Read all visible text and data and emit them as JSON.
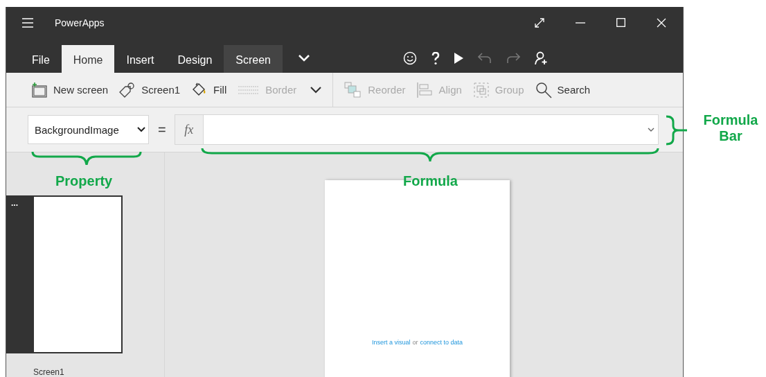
{
  "window": {
    "title": "PowerApps"
  },
  "tabs": [
    {
      "label": "File",
      "selected": false,
      "contextual": false
    },
    {
      "label": "Home",
      "selected": true,
      "contextual": false
    },
    {
      "label": "Insert",
      "selected": false,
      "contextual": false
    },
    {
      "label": "Design",
      "selected": false,
      "contextual": false
    },
    {
      "label": "Screen",
      "selected": false,
      "contextual": true
    }
  ],
  "app_actions": [
    {
      "kind": "smiley",
      "disabled": false
    },
    {
      "kind": "help",
      "disabled": false
    },
    {
      "kind": "play",
      "disabled": false
    },
    {
      "kind": "undo",
      "disabled": true
    },
    {
      "kind": "redo",
      "disabled": true
    },
    {
      "kind": "share",
      "disabled": false
    }
  ],
  "toolbar": {
    "left": [
      {
        "kind": "new-screen",
        "label": "New screen",
        "disabled": false
      },
      {
        "kind": "tag",
        "label": "Screen1",
        "disabled": false
      },
      {
        "kind": "fill",
        "label": "Fill",
        "disabled": false
      },
      {
        "kind": "border",
        "label": "Border",
        "disabled": true
      }
    ],
    "right": [
      {
        "kind": "reorder",
        "label": "Reorder",
        "disabled": true
      },
      {
        "kind": "align",
        "label": "Align",
        "disabled": true
      },
      {
        "kind": "group",
        "label": "Group",
        "disabled": true
      },
      {
        "kind": "search",
        "label": "Search",
        "disabled": false
      }
    ]
  },
  "formula_bar": {
    "property": "BackgroundImage",
    "equals": "=",
    "fx": "fx"
  },
  "screens": [
    {
      "label": "Screen1",
      "menu": "...",
      "selected": true
    }
  ],
  "canvas": {
    "parts": [
      {
        "kind": "link",
        "text": "Insert a visual"
      },
      {
        "kind": "text",
        "text": "or"
      },
      {
        "kind": "link",
        "text": "connect to data"
      }
    ]
  },
  "annotations": {
    "property": "Property",
    "formula": "Formula",
    "formula_bar": "Formula Bar"
  }
}
